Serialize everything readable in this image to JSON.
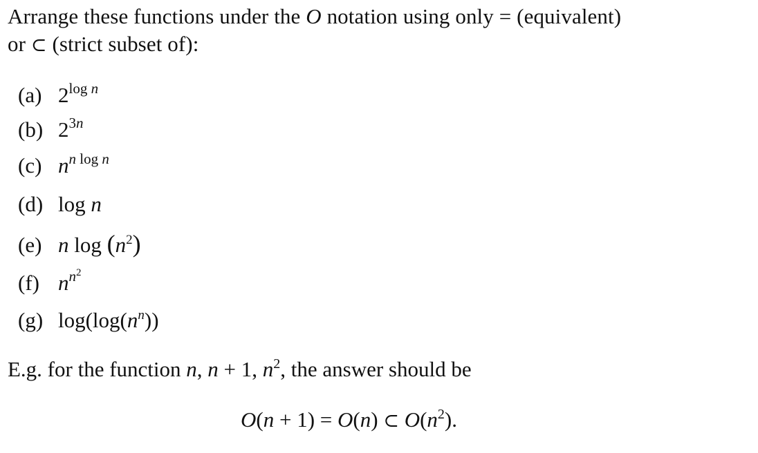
{
  "intro": {
    "line1_part1": "Arrange these functions under the ",
    "line1_O": "O",
    "line1_part2": " notation using only ",
    "line1_eq": "=",
    "line1_part3": " (equivalent)",
    "line2_part1": "or ",
    "line2_subset": "⊂",
    "line2_part2": " (strict subset of):"
  },
  "functions": [
    {
      "label": "(a)",
      "base": "2",
      "exponent": "log n"
    },
    {
      "label": "(b)",
      "base": "2",
      "exponent": "3n"
    },
    {
      "label": "(c)",
      "base": "n",
      "exponent": "n log n"
    },
    {
      "label": "(d)",
      "text": "log n"
    },
    {
      "label": "(e)",
      "text": "n log (n²)"
    },
    {
      "label": "(f)",
      "base": "n",
      "exponent": "n²"
    },
    {
      "label": "(g)",
      "text": "log(log(nⁿ))"
    }
  ],
  "example": {
    "prefix": "E.g. for the function ",
    "funcs": "n, n + 1, n², ",
    "suffix": "the answer should be",
    "answer": "O(n + 1) = O(n) ⊂ O(n²)."
  }
}
